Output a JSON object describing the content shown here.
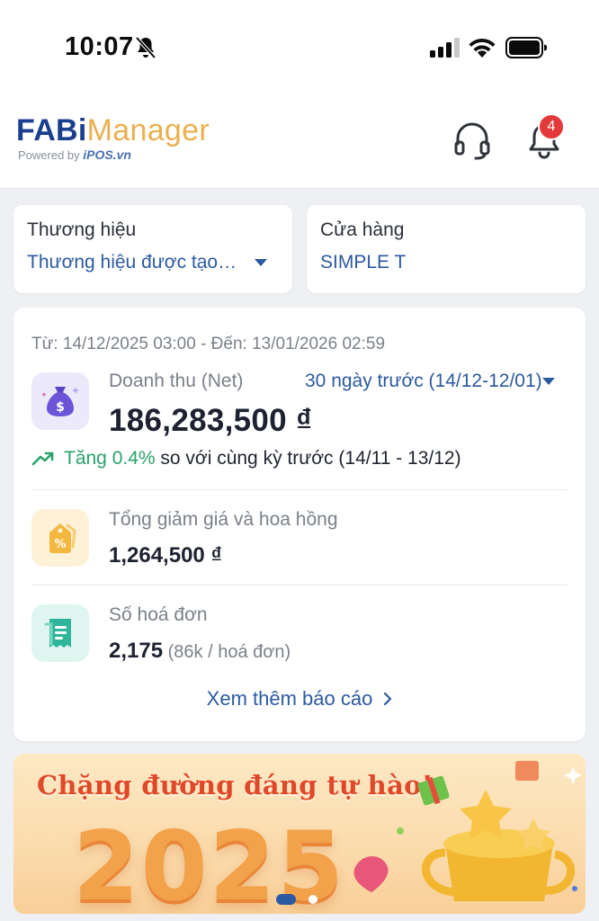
{
  "status_bar": {
    "time": "10:07"
  },
  "header": {
    "logo_primary": "FABi",
    "logo_secondary": "Manager",
    "powered_prefix": "Powered by",
    "powered_brand": "iPOS.vn",
    "notification_count": "4"
  },
  "brand_selector": {
    "label": "Thương hiệu",
    "value": "Thương hiệu được tạo tự động"
  },
  "store_selector": {
    "label": "Cửa hàng",
    "value": "SIMPLE T"
  },
  "summary": {
    "date_range": "Từ: 14/12/2025 03:00 - Đến: 13/01/2026 02:59",
    "revenue": {
      "label": "Doanh thu (Net)",
      "period": "30 ngày trước (14/12-12/01)",
      "value": "186,283,500 ₫",
      "trend_up": "Tăng 0.4%",
      "trend_rest": " so với cùng kỳ trước (14/11 - 13/12)"
    },
    "discount": {
      "label": "Tổng giảm giá và hoa hồng",
      "value": "1,264,500 ₫"
    },
    "invoices": {
      "label": "Số hoá đơn",
      "value": "2,175",
      "sub": " (86k / hoá đơn)"
    },
    "more_link": "Xem thêm báo cáo"
  },
  "banner": {
    "title": "Chặng đường đáng tự hào!",
    "year": "2025"
  },
  "colors": {
    "accent_blue": "#2c5aa0",
    "logo_blue": "#1b3f8f",
    "logo_gold": "#eab050",
    "trend_green": "#2aa26a",
    "badge_red": "#e23a3a"
  },
  "icons": {
    "status": [
      "bell-slash-icon",
      "cellular-signal-icon",
      "wifi-icon",
      "battery-icon"
    ],
    "header": [
      "headset-icon",
      "bell-icon"
    ],
    "summary": [
      "money-bag-icon",
      "discount-tag-icon",
      "receipt-icon",
      "trending-up-icon",
      "chevron-right-icon",
      "chevron-down-icon"
    ]
  }
}
